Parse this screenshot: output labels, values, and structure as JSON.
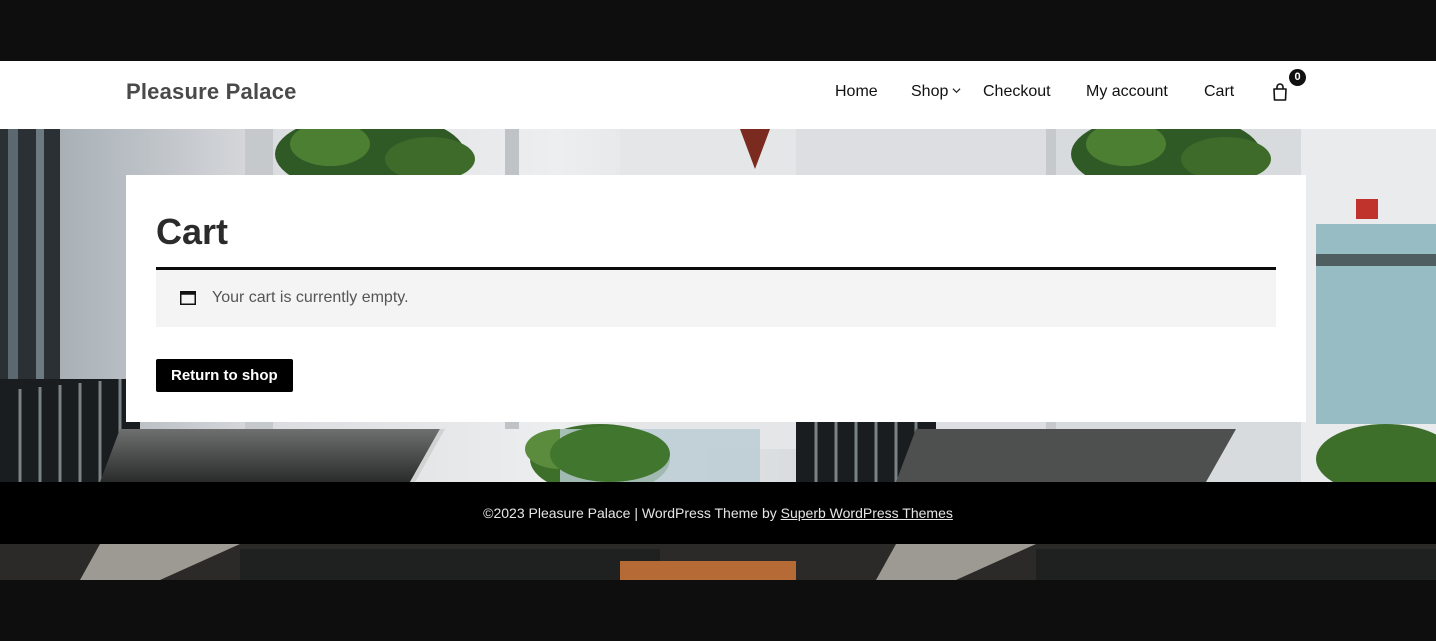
{
  "site": {
    "title": "Pleasure Palace"
  },
  "nav": {
    "items": [
      {
        "label": "Home"
      },
      {
        "label": "Shop"
      },
      {
        "label": "Checkout"
      },
      {
        "label": "My account"
      },
      {
        "label": "Cart"
      }
    ],
    "cart_count": "0",
    "icons": {
      "shop_dropdown": "chevron-down-icon",
      "cart": "shopping-bag-icon"
    }
  },
  "main": {
    "title": "Cart",
    "notice": {
      "icon": "window-icon",
      "text": "Your cart is currently empty."
    },
    "return_button": "Return to shop"
  },
  "footer": {
    "text": "©2023 Pleasure Palace | WordPress Theme by ",
    "link_text": "Superb WordPress Themes"
  },
  "colors": {
    "page_bg": "#0e0e0e",
    "footer_bg": "#000000",
    "button_bg": "#000000",
    "notice_bg": "#f4f4f4"
  }
}
